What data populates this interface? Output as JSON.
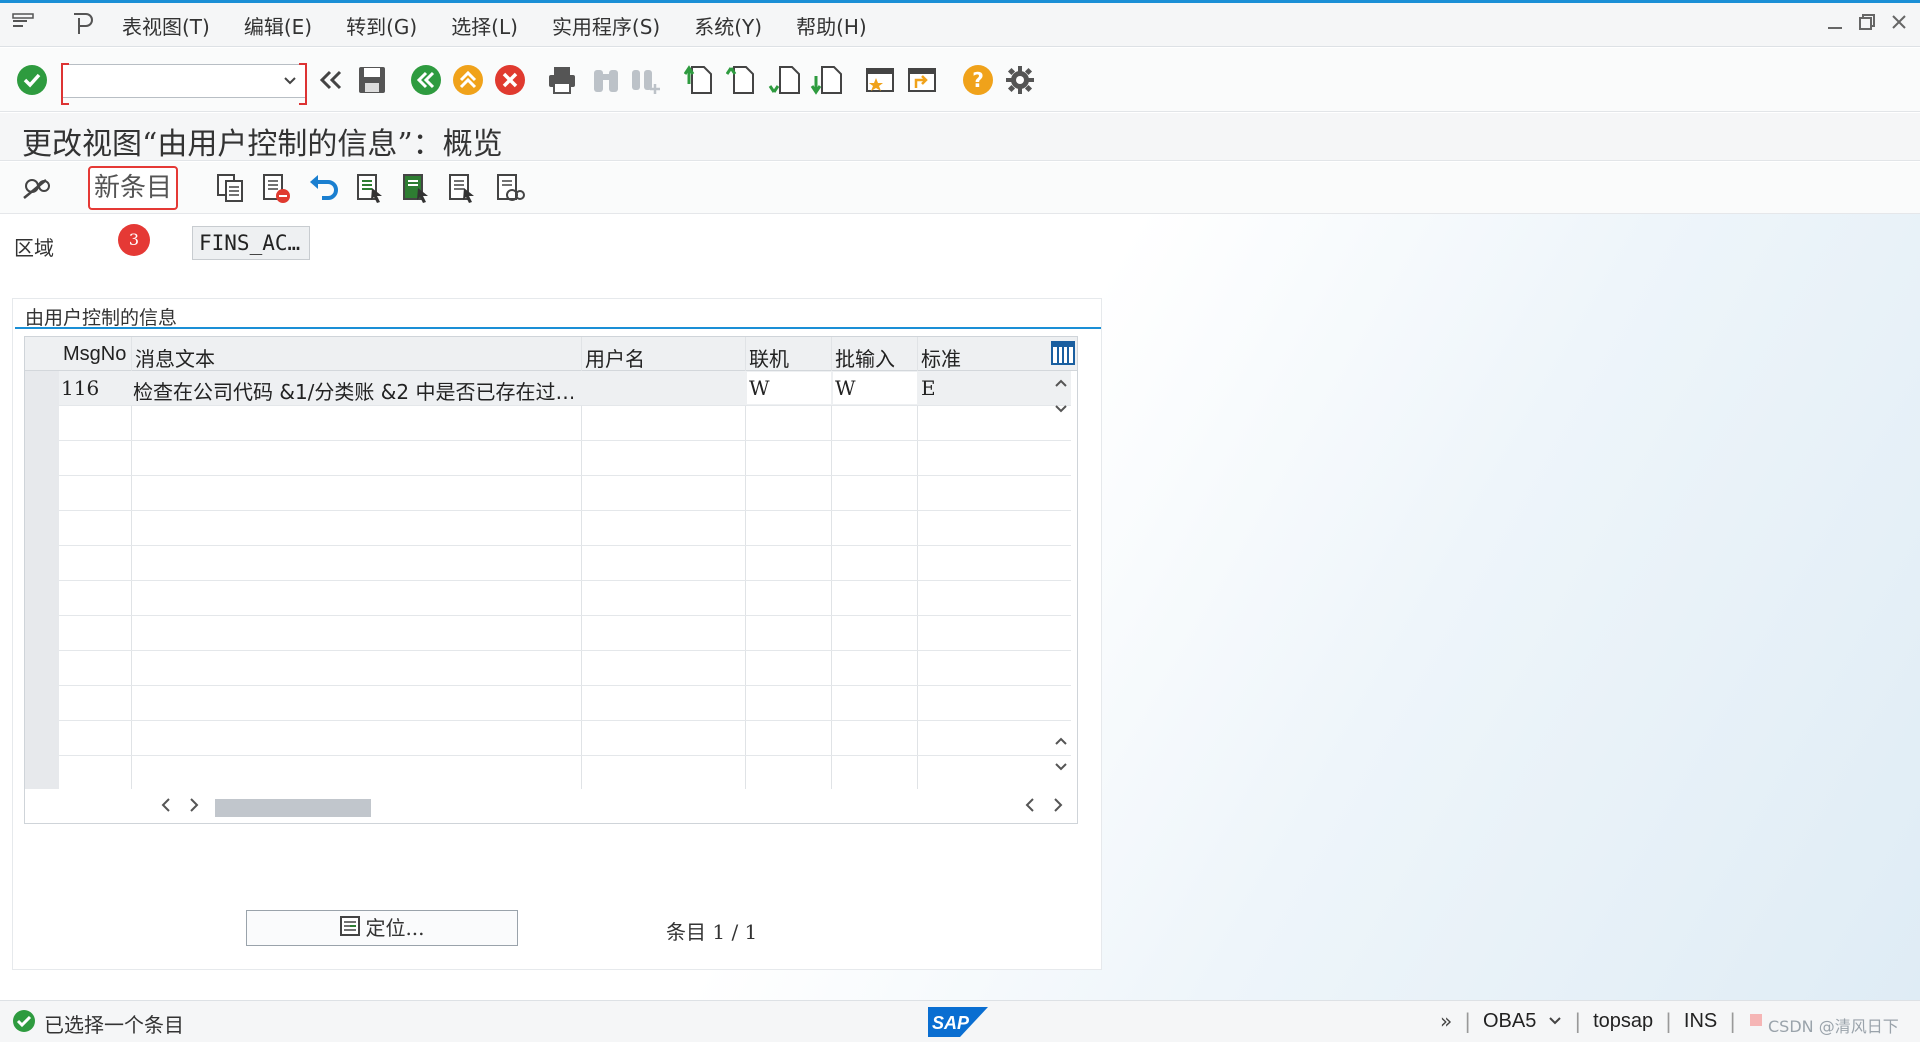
{
  "menubar": {
    "items": [
      "表视图(T)",
      "编辑(E)",
      "转到(G)",
      "选择(L)",
      "实用程序(S)",
      "系统(Y)",
      "帮助(H)"
    ]
  },
  "toolbar": {
    "command_field_value": ""
  },
  "title": "更改视图“由用户控制的信息”：概览",
  "app_toolbar": {
    "new_entry_label": "新条目"
  },
  "area": {
    "label": "区域",
    "badge": "3",
    "value": "FINS_AC…"
  },
  "group": {
    "title": "由用户控制的信息"
  },
  "table": {
    "columns": [
      "MsgNo",
      "消息文本",
      "用户名",
      "联机",
      "批输入",
      "标准"
    ],
    "rows": [
      {
        "msgno": "116",
        "text": "检查在公司代码 &1/分类账 &2 中是否已存在过…",
        "user": "",
        "online": "W",
        "batch": "W",
        "standard": "E"
      }
    ]
  },
  "footer": {
    "locate_label": "定位...",
    "entry_count": "条目 1 / 1"
  },
  "statusbar": {
    "message": "已选择一个条目",
    "transaction": "OBA5",
    "system": "topsap",
    "mode": "INS",
    "watermark": "CSDN @清风日下"
  },
  "colors": {
    "accent": "#1a8fd6",
    "highlight_red": "#e53935",
    "ok_green": "#2e9b3f",
    "cancel_red": "#e03a2f",
    "nav_orange": "#f0a21a"
  }
}
